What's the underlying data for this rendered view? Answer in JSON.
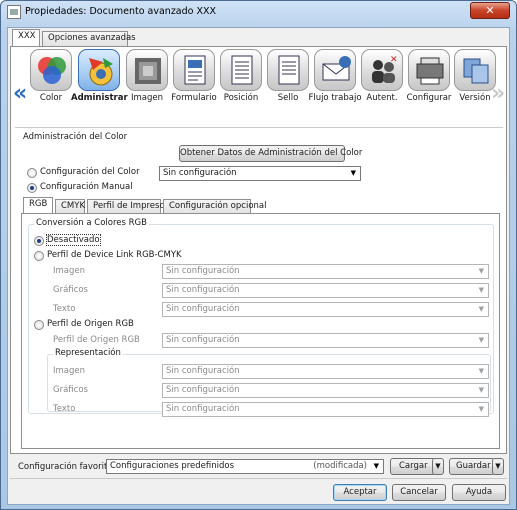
{
  "window": {
    "title": "Propiedades: Documento avanzado XXX",
    "close_glyph": "✕"
  },
  "top_tabs": [
    "XXX",
    "Opciones avanzadas"
  ],
  "toolbar": {
    "left_arrow": "«",
    "right_arrow": "»",
    "items": [
      {
        "label": "Color",
        "icon": "color-circles-icon"
      },
      {
        "label": "Administrar",
        "icon": "palette-gear-icon",
        "selected": true
      },
      {
        "label": "Imagen",
        "icon": "image-halftone-icon"
      },
      {
        "label": "Formulario",
        "icon": "form-document-icon"
      },
      {
        "label": "Posición",
        "icon": "position-document-icon"
      },
      {
        "label": "Sello",
        "icon": "stamp-document-icon"
      },
      {
        "label": "Flujo trabajo",
        "icon": "workflow-envelope-icon"
      },
      {
        "label": "Autent.",
        "icon": "authentication-users-icon"
      },
      {
        "label": "Configurar",
        "icon": "printer-configure-icon"
      },
      {
        "label": "Versión",
        "icon": "version-icon"
      }
    ]
  },
  "color_admin": {
    "section_title": "Administración del Color",
    "obtain_button": "Obtener Datos de Administración del Color",
    "color_config_label": "Configuración del Color",
    "color_config_value": "Sin configuración",
    "manual_config_label": "Configuración Manual"
  },
  "inner_tabs": [
    "RGB",
    "CMYK",
    "Perfil de Impresora",
    "Configuración opcional"
  ],
  "rgb": {
    "group_title": "Conversión a Colores RGB",
    "off_label": "Desactivado",
    "device_link_label": "Perfil de Device Link RGB-CMYK",
    "device_link_rows": [
      {
        "label": "Imagen",
        "value": "Sin configuración"
      },
      {
        "label": "Gráficos",
        "value": "Sin configuración"
      },
      {
        "label": "Texto",
        "value": "Sin configuración"
      }
    ],
    "origin_label": "Perfil de Origen RGB",
    "origin_row": {
      "label": "Perfil de Origen RGB",
      "value": "Sin configuración"
    },
    "rendering_title": "Representación",
    "rendering_rows": [
      {
        "label": "Imagen",
        "value": "Sin configuración"
      },
      {
        "label": "Gráficos",
        "value": "Sin configuración"
      },
      {
        "label": "Texto",
        "value": "Sin configuración"
      }
    ]
  },
  "favorites": {
    "label": "Configuración favorita",
    "value": "Configuraciones predefinidos",
    "modified": "(modificada)",
    "load_button": "Cargar",
    "save_button": "Guardar"
  },
  "footer": {
    "ok": "Aceptar",
    "cancel": "Cancelar",
    "help": "Ayuda"
  }
}
